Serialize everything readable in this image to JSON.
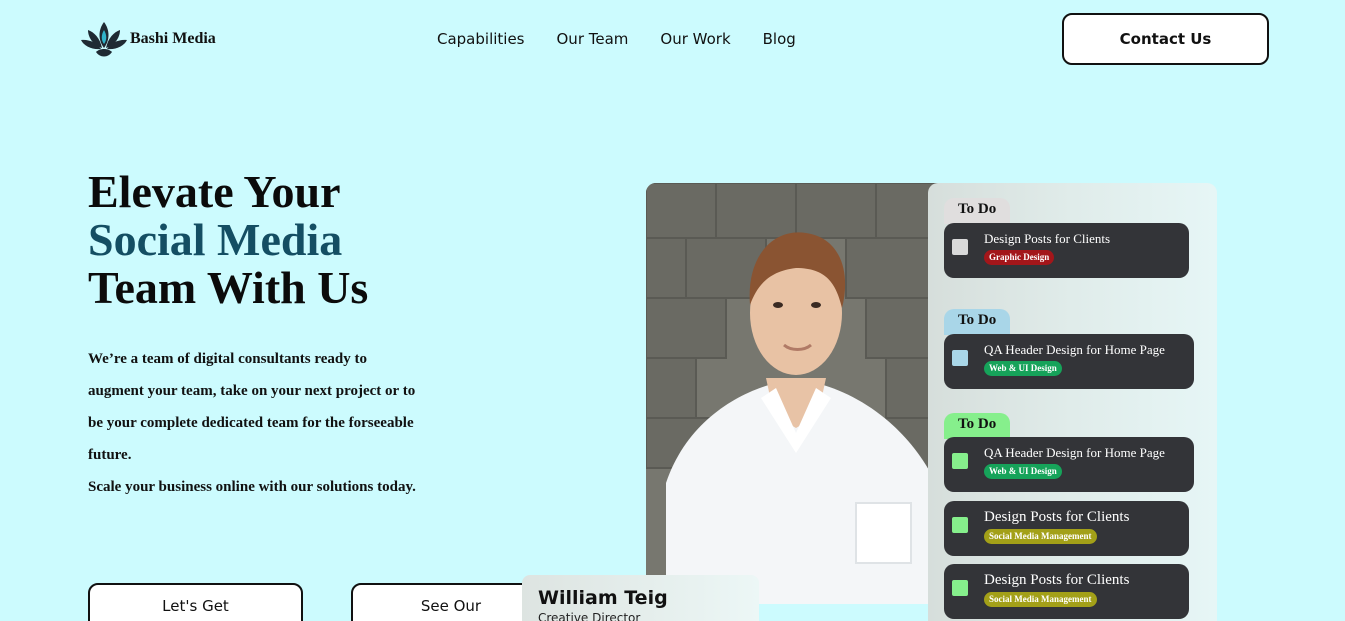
{
  "brand": {
    "name": "Bashi Media"
  },
  "nav": {
    "items": [
      "Capabilities",
      "Our Team",
      "Our Work",
      "Blog"
    ]
  },
  "header": {
    "contact_label": "Contact Us"
  },
  "hero": {
    "title_line1": "Elevate Your",
    "title_line2": "Social Media",
    "title_line3": "Team With Us",
    "desc1": "We’re a team of digital consultants ready to augment your team, take on your next project or to be your complete dedicated team for the forseeable future.",
    "desc2": "Scale your business online with our solutions today.",
    "cta_primary": "Let's Get",
    "cta_secondary": "See Our"
  },
  "person": {
    "name": "William Teig",
    "role": "Creative Director"
  },
  "tasks": [
    {
      "tag": "To Do",
      "tag_color": "#e0dede",
      "title": "Design Posts for Clients",
      "badge": "Graphic Design",
      "badge_color": "#a3161a",
      "checkbox_color": "#d9d9d9"
    },
    {
      "tag": "To Do",
      "tag_color": "#a9d6e8",
      "title": "QA Header Design for Home Page",
      "badge": "Web & UI Design",
      "badge_color": "#16a35a",
      "checkbox_color": "#a9d6e8"
    },
    {
      "tag": "To Do",
      "tag_color": "#86ef8c",
      "title": "QA Header Design for Home Page",
      "badge": "Web & UI Design",
      "badge_color": "#16a35a",
      "checkbox_color": "#86ef8c"
    },
    {
      "title": "Design Posts for Clients",
      "badge": "Social Media Management",
      "badge_color": "#a3a018",
      "checkbox_color": "#86ef8c"
    },
    {
      "title": "Design Posts for Clients",
      "badge": "Social Media Management",
      "badge_color": "#a3a018",
      "checkbox_color": "#86ef8c"
    }
  ],
  "colors": {
    "background": "#ccfbfe",
    "accent": "#144e63",
    "card_dark": "#333438"
  }
}
